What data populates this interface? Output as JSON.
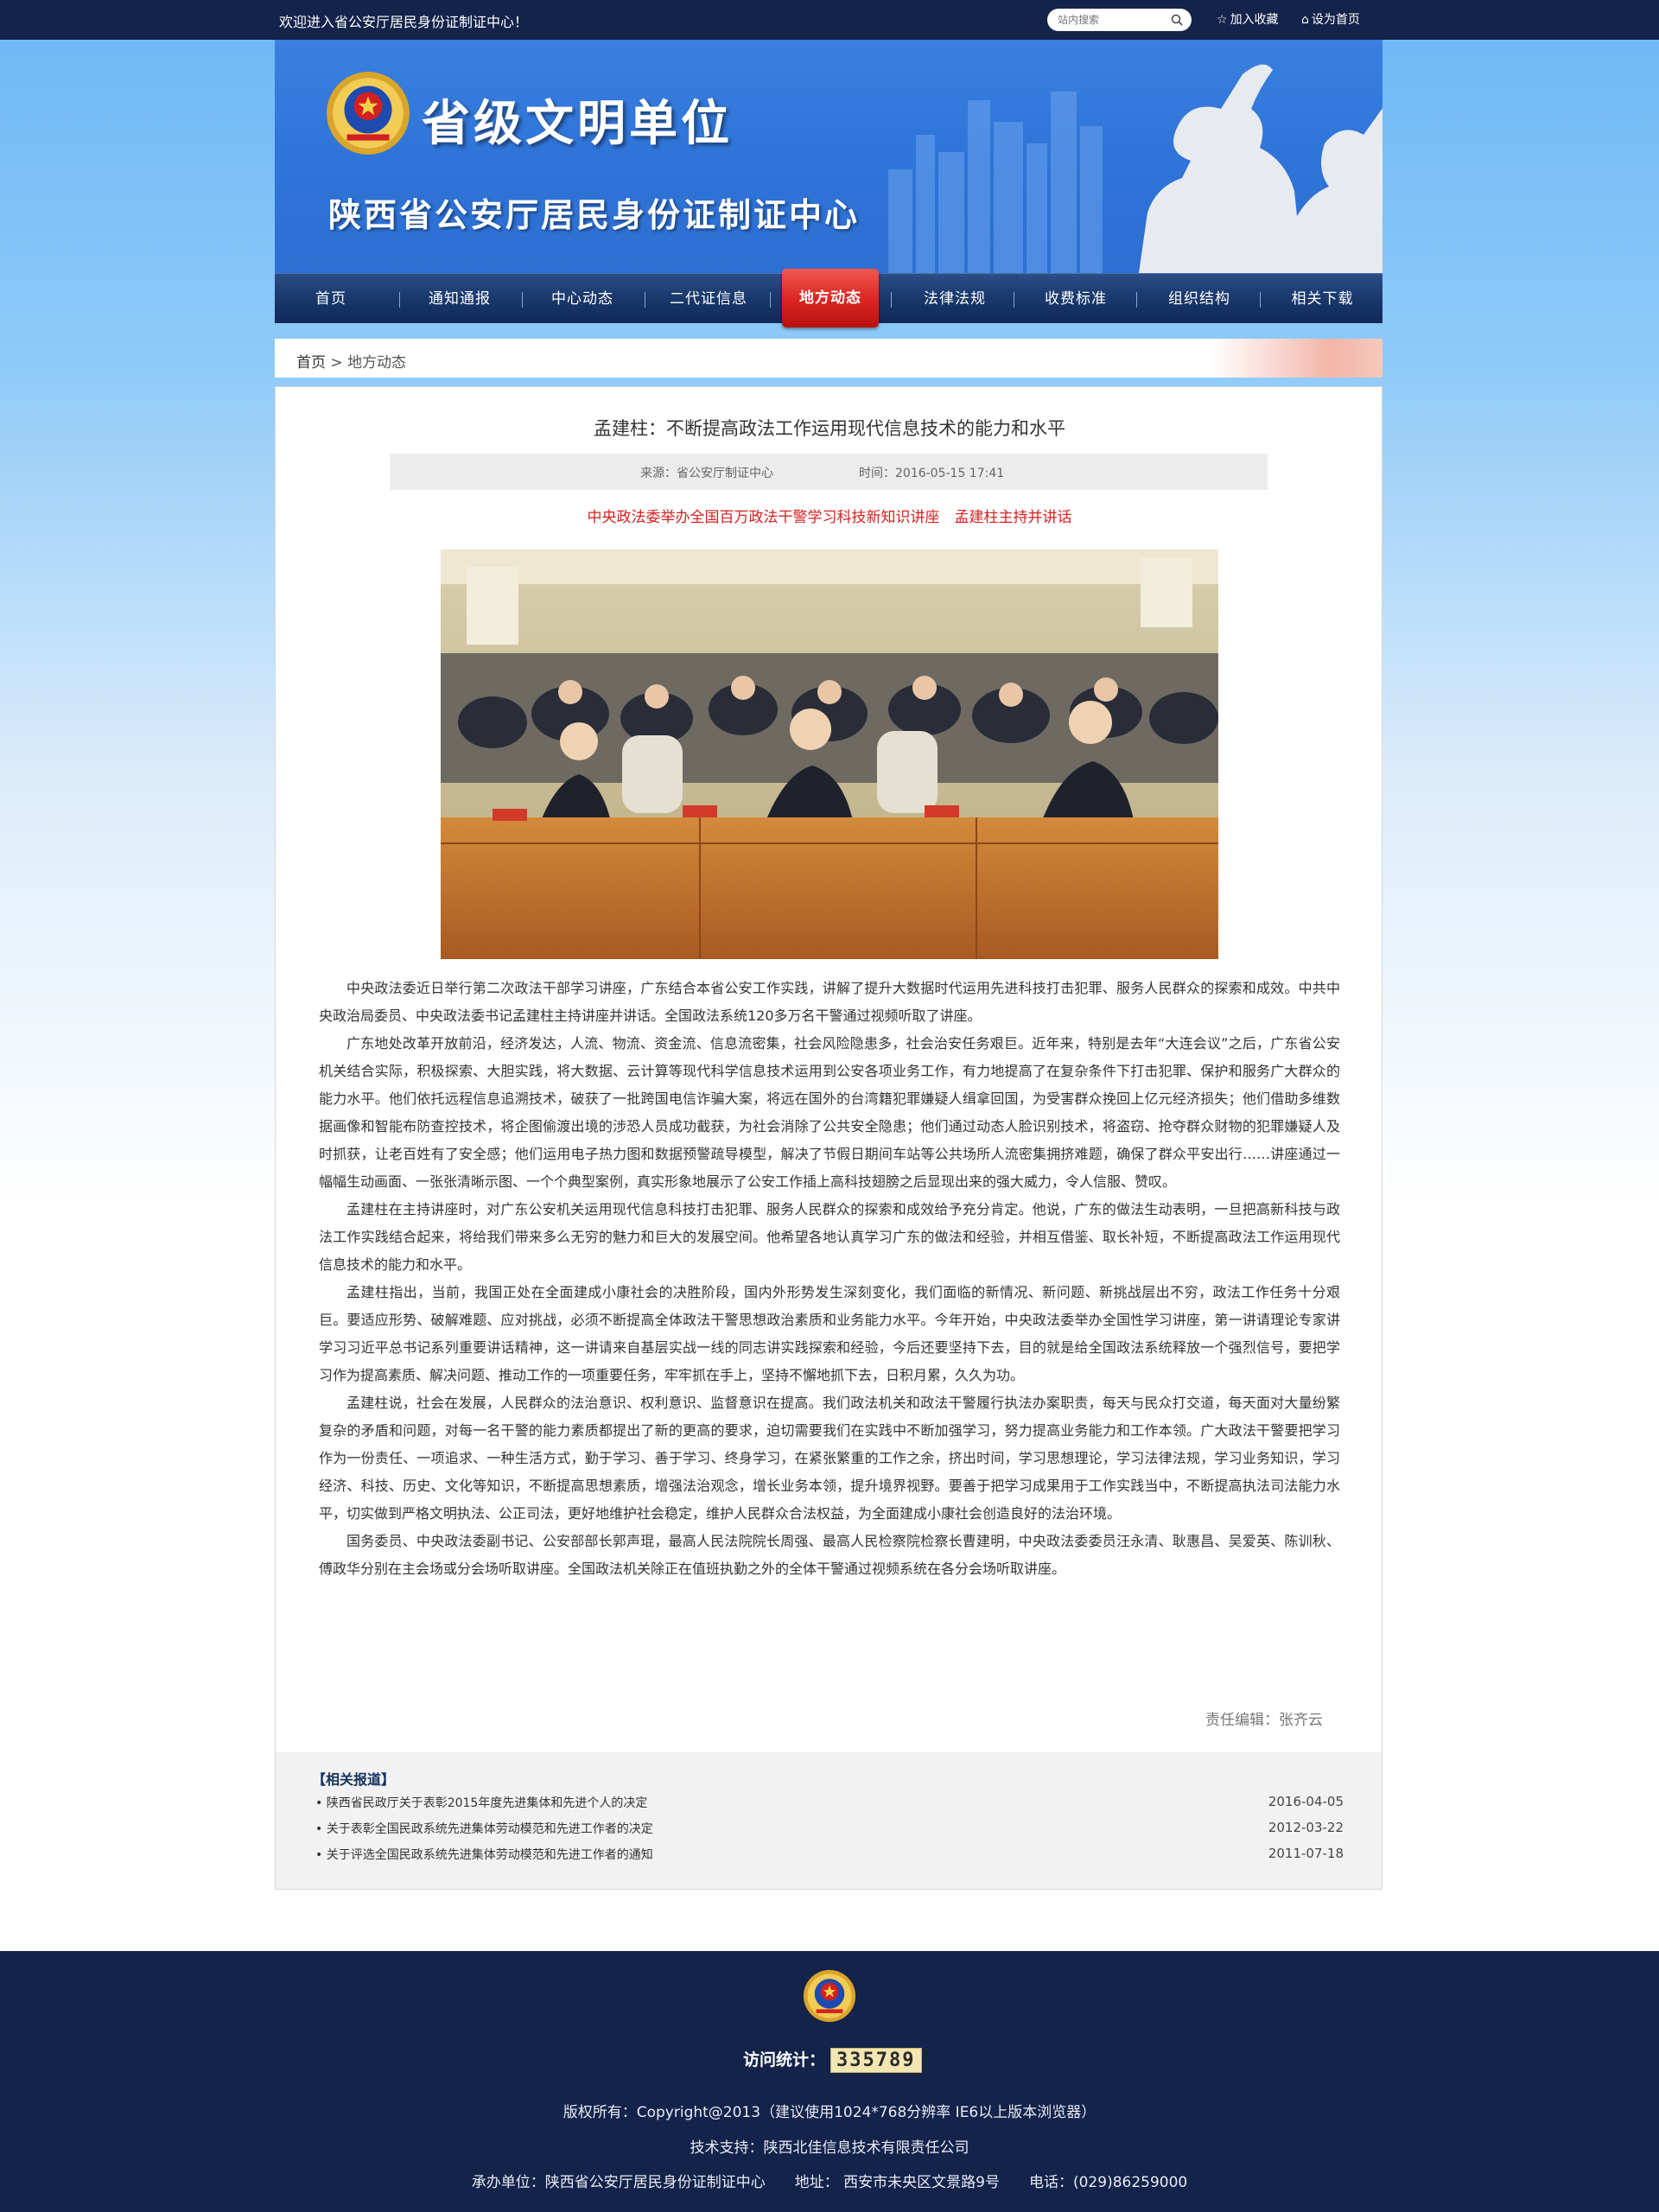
{
  "topbar": {
    "welcome": "欢迎进入省公安厅居民身份证制证中心！",
    "search_placeholder": "站内搜索",
    "bookmark": "加入收藏",
    "homepage": "设为首页"
  },
  "banner": {
    "title": "省级文明单位",
    "subtitle": "陕西省公安厅居民身份证制证中心"
  },
  "nav": [
    {
      "label": "首页"
    },
    {
      "label": "通知通报"
    },
    {
      "label": "中心动态"
    },
    {
      "label": "二代证信息"
    },
    {
      "label": "地方动态"
    },
    {
      "label": "法律法规"
    },
    {
      "label": "收费标准"
    },
    {
      "label": "组织结构"
    },
    {
      "label": "相关下载"
    }
  ],
  "breadcrumb": {
    "home": "首页",
    "sep": " > ",
    "current": "地方动态"
  },
  "article": {
    "title": "孟建柱：不断提高政法工作运用现代信息技术的能力和水平",
    "source": "来源：省公安厅制证中心",
    "time": "时间：2016-05-15 17:41",
    "subtitle": "中央政法委举办全国百万政法干警学习科技新知识讲座　孟建柱主持并讲话",
    "paragraphs": [
      "中央政法委近日举行第二次政法干部学习讲座，广东结合本省公安工作实践，讲解了提升大数据时代运用先进科技打击犯罪、服务人民群众的探索和成效。中共中央政治局委员、中央政法委书记孟建柱主持讲座并讲话。全国政法系统120多万名干警通过视频听取了讲座。",
      "广东地处改革开放前沿，经济发达，人流、物流、资金流、信息流密集，社会风险隐患多，社会治安任务艰巨。近年来，特别是去年“大连会议”之后，广东省公安机关结合实际，积极探索、大胆实践，将大数据、云计算等现代科学信息技术运用到公安各项业务工作，有力地提高了在复杂条件下打击犯罪、保护和服务广大群众的能力水平。他们依托远程信息追溯技术，破获了一批跨国电信诈骗大案，将远在国外的台湾籍犯罪嫌疑人缉拿回国，为受害群众挽回上亿元经济损失；他们借助多维数据画像和智能布防查控技术，将企图偷渡出境的涉恐人员成功截获，为社会消除了公共安全隐患；他们通过动态人脸识别技术，将盗窃、抢夺群众财物的犯罪嫌疑人及时抓获，让老百姓有了安全感；他们运用电子热力图和数据预警疏导模型，解决了节假日期间车站等公共场所人流密集拥挤难题，确保了群众平安出行……讲座通过一幅幅生动画面、一张张清晰示图、一个个典型案例，真实形象地展示了公安工作插上高科技翅膀之后显现出来的强大威力，令人信服、赞叹。",
      "孟建柱在主持讲座时，对广东公安机关运用现代信息科技打击犯罪、服务人民群众的探索和成效给予充分肯定。他说，广东的做法生动表明，一旦把高新科技与政法工作实践结合起来，将给我们带来多么无穷的魅力和巨大的发展空间。他希望各地认真学习广东的做法和经验，并相互借鉴、取长补短，不断提高政法工作运用现代信息技术的能力和水平。",
      "孟建柱指出，当前，我国正处在全面建成小康社会的决胜阶段，国内外形势发生深刻变化，我们面临的新情况、新问题、新挑战层出不穷，政法工作任务十分艰巨。要适应形势、破解难题、应对挑战，必须不断提高全体政法干警思想政治素质和业务能力水平。今年开始，中央政法委举办全国性学习讲座，第一讲请理论专家讲学习习近平总书记系列重要讲话精神，这一讲请来自基层实战一线的同志讲实践探索和经验，今后还要坚持下去，目的就是给全国政法系统释放一个强烈信号，要把学习作为提高素质、解决问题、推动工作的一项重要任务，牢牢抓在手上，坚持不懈地抓下去，日积月累，久久为功。",
      "孟建柱说，社会在发展，人民群众的法治意识、权利意识、监督意识在提高。我们政法机关和政法干警履行执法办案职责，每天与民众打交道，每天面对大量纷繁复杂的矛盾和问题，对每一名干警的能力素质都提出了新的更高的要求，迫切需要我们在实践中不断加强学习，努力提高业务能力和工作本领。广大政法干警要把学习作为一份责任、一项追求、一种生活方式，勤于学习、善于学习、终身学习，在紧张繁重的工作之余，挤出时间，学习思想理论，学习法律法规，学习业务知识，学习经济、科技、历史、文化等知识，不断提高思想素质，增强法治观念，增长业务本领，提升境界视野。要善于把学习成果用于工作实践当中，不断提高执法司法能力水平，切实做到严格文明执法、公正司法，更好地维护社会稳定，维护人民群众合法权益，为全面建成小康社会创造良好的法治环境。",
      "国务委员、中央政法委副书记、公安部部长郭声琨，最高人民法院院长周强、最高人民检察院检察长曹建明，中央政法委委员汪永清、耿惠昌、吴爱英、陈训秋、傅政华分别在主会场或分会场听取讲座。全国政法机关除正在值班执勤之外的全体干警通过视频系统在各分会场听取讲座。"
    ],
    "editor": "责任编辑：张齐云"
  },
  "related": {
    "heading": "【相关报道】",
    "items": [
      {
        "title": "• 陕西省民政厅关于表彰2015年度先进集体和先进个人的决定",
        "date": "2016-04-05"
      },
      {
        "title": "• 关于表彰全国民政系统先进集体劳动模范和先进工作者的决定",
        "date": "2012-03-22"
      },
      {
        "title": "• 关于评选全国民政系统先进集体劳动模范和先进工作者的通知",
        "date": "2011-07-18"
      }
    ]
  },
  "footer": {
    "visit_label": "访问统计：",
    "visit_count": "335789",
    "copyright": "版权所有：Copyright@2013（建议使用1024*768分辨率  IE6以上版本浏览器）",
    "support": "技术支持：陕西北佳信息技术有限责任公司",
    "organizer": "承办单位：陕西省公安厅居民身份证制证中心　　地址： 西安市未央区文景路9号　　电话：(029)86259000"
  },
  "colors": {
    "topbar_bg": "#13234a",
    "nav_active": "#d92420",
    "subtitle_red": "#d62020",
    "banner_blue": "#2f74d8"
  },
  "icons": [
    "search-icon",
    "star-icon",
    "home-icon",
    "police-emblem-icon"
  ]
}
